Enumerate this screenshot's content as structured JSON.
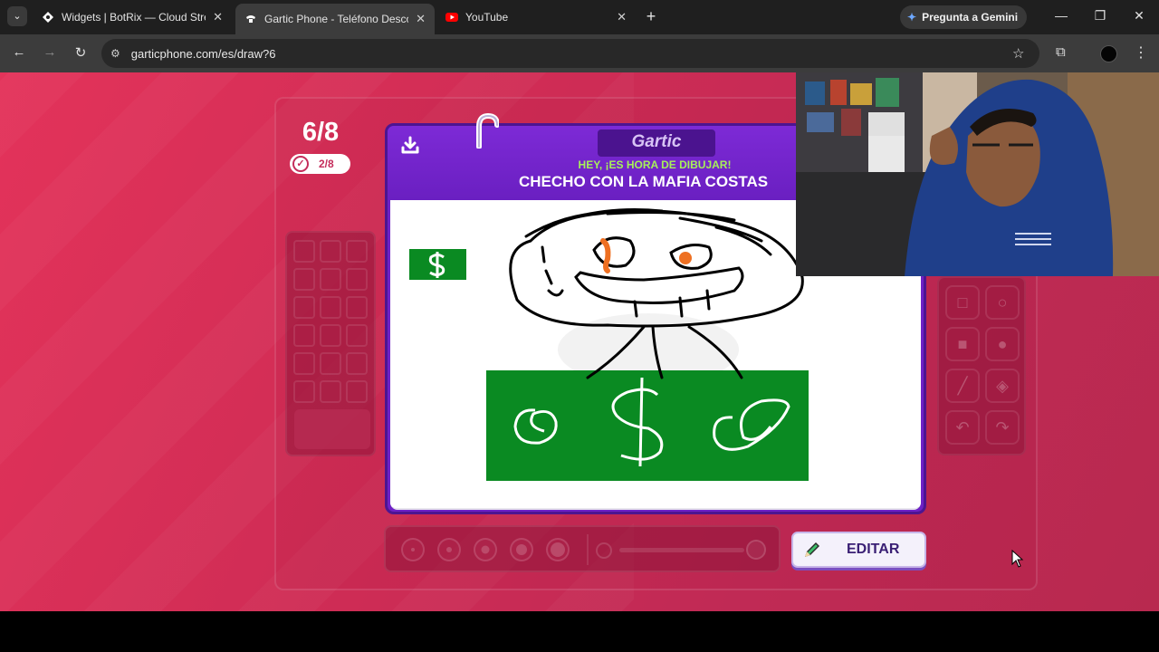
{
  "browser": {
    "tabs": [
      {
        "title": "Widgets | BotRix — Cloud Strea",
        "active": false,
        "favicon": "botrix-icon"
      },
      {
        "title": "Gartic Phone - Teléfono Descon",
        "active": true,
        "favicon": "gartic-icon"
      },
      {
        "title": "YouTube",
        "active": false,
        "favicon": "youtube-icon"
      }
    ],
    "gemini_label": "Pregunta a Gemini",
    "url": "garticphone.com/es/draw?6"
  },
  "game": {
    "round": "6/8",
    "done_count": "2/8",
    "logo": "Gartic",
    "prompt_header": "HEY, ¡ES HORA DE DIBUJAR!",
    "phrase": "CHECHO CON LA MAFIA COSTAS",
    "edit_label": "EDITAR"
  },
  "colors": {
    "background": "#d42f58",
    "card_purple": "#6e21c6",
    "money_green": "#0a8a22",
    "header_green": "#a6f05a"
  }
}
